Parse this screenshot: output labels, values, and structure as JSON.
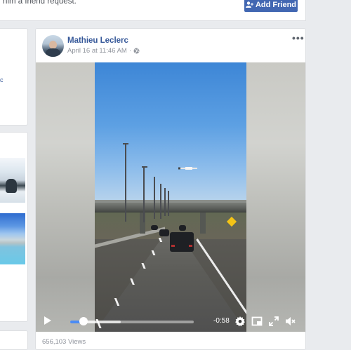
{
  "friend_request": {
    "text": "him a friend request.",
    "add_friend_label": "Add Friend"
  },
  "left_column": {
    "link_fragment": "c"
  },
  "post": {
    "author": "Mathieu Leclerc",
    "timestamp": "April 16 at 11:46 AM",
    "separator": "·",
    "privacy_icon": "globe-icon",
    "more_label": "•••",
    "video": {
      "progress": 0.11,
      "buffered": 0.41,
      "time_remaining": "-0:58",
      "icons": [
        "play-icon",
        "settings-icon",
        "pip-icon",
        "fullscreen-icon",
        "mute-icon"
      ]
    },
    "views": "656,103 Views"
  },
  "colors": {
    "accent": "#4267b2",
    "link": "#365899",
    "progress": "#4b8bf4",
    "page_bg": "#e9ebee"
  }
}
